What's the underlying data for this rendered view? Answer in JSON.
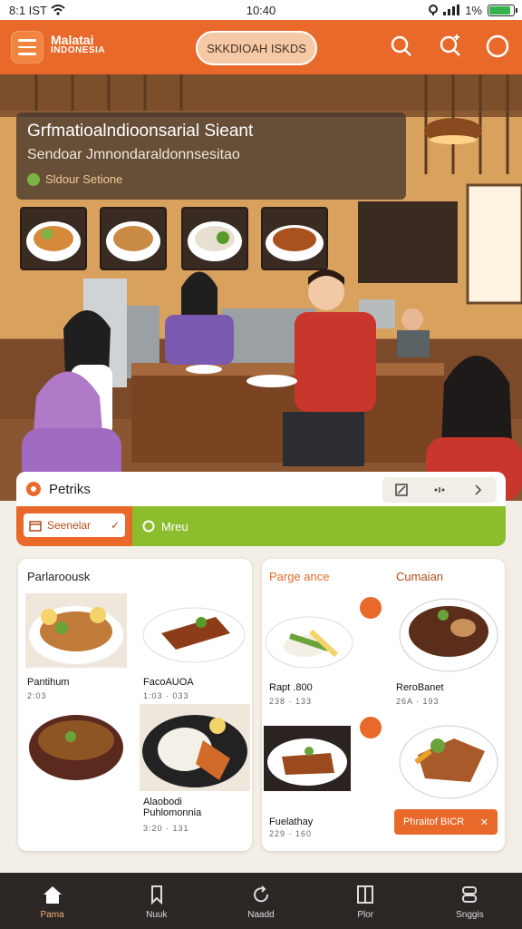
{
  "status_bar": {
    "carrier": "8:1 IST",
    "time": "10:40",
    "battery_percent": "1%",
    "battery_level": 0.9
  },
  "header": {
    "logo_line1": "Malatai",
    "logo_line2": "INDONESIA",
    "search_text": "SKKDIOAH ISKDS"
  },
  "hero": {
    "title": "Grfmatioalndioonsarial Sieant",
    "subtitle": "Sendoar Jmnondaraldonnsesitao",
    "tag": "Sldour Setione"
  },
  "panel": {
    "title": "Petriks",
    "tab1": "Seenelar",
    "tab2": "Mreu"
  },
  "left_card": {
    "header": "Parlaroousk",
    "items": [
      {
        "name": "Pantihum",
        "price": "2:03"
      },
      {
        "name": "FacoAUOA",
        "price": "1:03 · 033"
      },
      {
        "name": "",
        "price": ""
      },
      {
        "name": "Alaobodi Puhlomonnia",
        "price": "3:20 · 131"
      }
    ]
  },
  "right_card": {
    "header_left": "Parge ance",
    "header_right": "Cumaian",
    "items": [
      {
        "name": "Rapt .800",
        "price": "238 · 133"
      },
      {
        "name": "ReroBanet",
        "price": "26A · 193"
      },
      {
        "name": "Fuelathay",
        "price": "229 · 160"
      }
    ],
    "order_button": "Phraitof BICR"
  },
  "nav": [
    {
      "label": "Pama",
      "icon": "home-icon"
    },
    {
      "label": "Nuuk",
      "icon": "bookmark-icon"
    },
    {
      "label": "Naadd",
      "icon": "refresh-icon"
    },
    {
      "label": "Plor",
      "icon": "book-icon"
    },
    {
      "label": "Snggis",
      "icon": "settings-icon"
    }
  ],
  "colors": {
    "accent": "#e9692a",
    "green": "#8bbd2c",
    "nav_bg": "#2c2724"
  }
}
